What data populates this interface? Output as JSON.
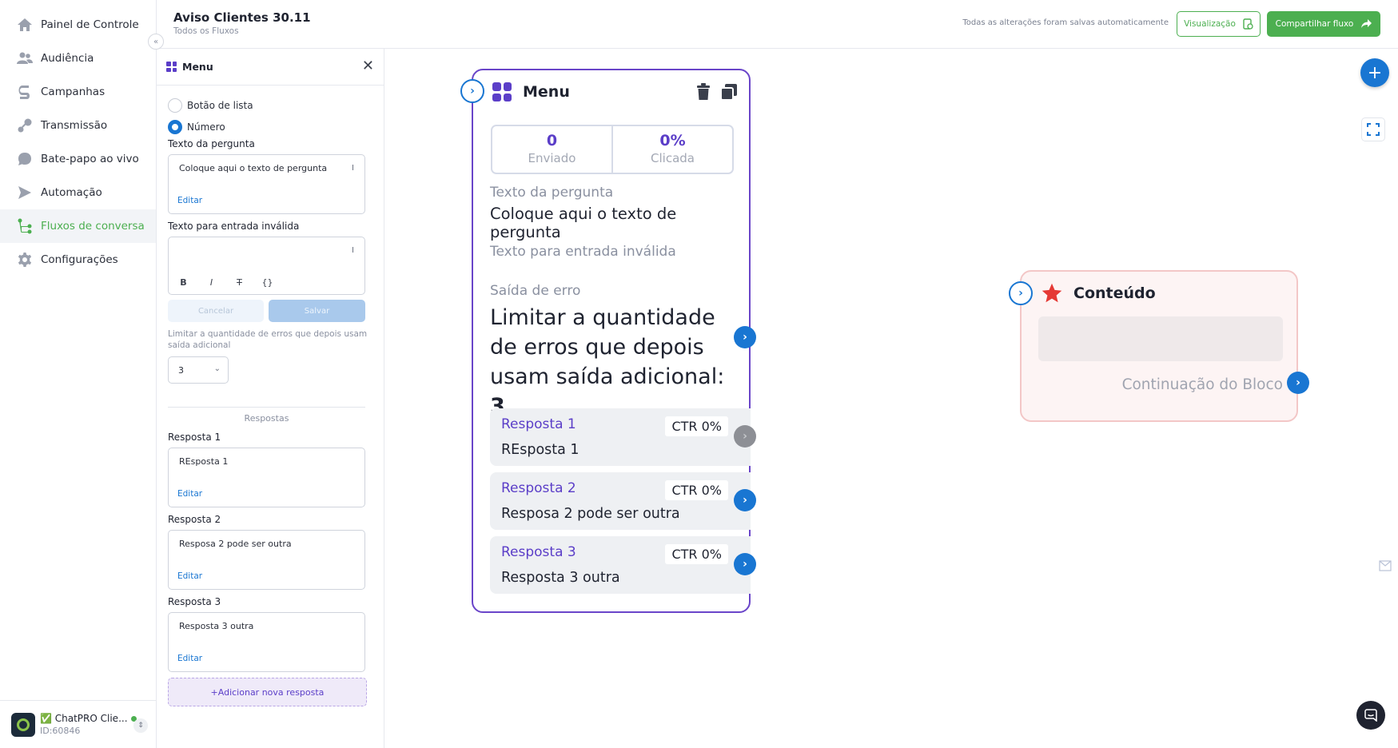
{
  "app": {
    "flow_title": "Aviso Clientes 30.11",
    "flow_subtitle": "Todos os Fluxos",
    "saved_status": "Todas as alterações foram salvas automaticamente",
    "preview_label": "Visualização",
    "share_label": "Compartilhar fluxo",
    "accent_color": "#4caf50",
    "primary_color": "#1976d2",
    "menu_color": "#6a45c9"
  },
  "sidebar": {
    "items": [
      {
        "label": "Painel de Controle",
        "icon": "home-icon"
      },
      {
        "label": "Audiência",
        "icon": "users-icon"
      },
      {
        "label": "Campanhas",
        "icon": "campaign-icon"
      },
      {
        "label": "Transmissão",
        "icon": "broadcast-icon"
      },
      {
        "label": "Bate-papo ao vivo",
        "icon": "chat-icon"
      },
      {
        "label": "Automação",
        "icon": "automation-icon"
      },
      {
        "label": "Fluxos de conversa",
        "icon": "flow-icon",
        "active": true
      },
      {
        "label": "Configurações",
        "icon": "gear-icon"
      }
    ],
    "account": {
      "name": "✅ ChatPRO Clie...",
      "id": "ID:60846"
    }
  },
  "panel": {
    "title": "Menu",
    "radio_list_label": "Botão de lista",
    "radio_number_label": "Número",
    "question_label": "Texto da pergunta",
    "question_value": "Coloque aqui o texto de pergunta",
    "edit_label": "Editar",
    "invalid_label": "Texto para entrada inválida",
    "invalid_value": "",
    "cancel_label": "Cancelar",
    "save_label": "Salvar",
    "error_hint": "Limitar a quantidade de erros que depois usam saída adicional",
    "error_limit_value": "3",
    "responses_caption": "Respostas",
    "responses": [
      {
        "label": "Resposta 1",
        "value": "REsposta 1"
      },
      {
        "label": "Resposta 2",
        "value": "Resposa 2 pode ser outra"
      },
      {
        "label": "Resposta 3",
        "value": "Resposta 3 outra"
      }
    ],
    "add_response_label": "+Adicionar nova resposta"
  },
  "node_menu": {
    "title": "Menu",
    "sent_value": "0",
    "sent_label": "Enviado",
    "clicked_value": "0%",
    "clicked_label": "Clicada",
    "question_label": "Texto da pergunta",
    "question_value": "Coloque aqui o texto de pergunta",
    "invalid_label": "Texto para entrada inválida",
    "error_label": "Saída de erro",
    "error_text": "Limitar a quantidade de erros que depois usam saída adicional:",
    "error_value": "3",
    "responses": [
      {
        "title": "Resposta 1",
        "value": "REsposta 1",
        "ctr": "CTR 0%"
      },
      {
        "title": "Resposta 2",
        "value": "Resposa 2 pode ser outra",
        "ctr": "CTR 0%"
      },
      {
        "title": "Resposta 3",
        "value": "Resposta 3 outra",
        "ctr": "CTR 0%"
      }
    ]
  },
  "node_content": {
    "title": "Conteúdo",
    "continuation_label": "Continuação do Bloco"
  }
}
